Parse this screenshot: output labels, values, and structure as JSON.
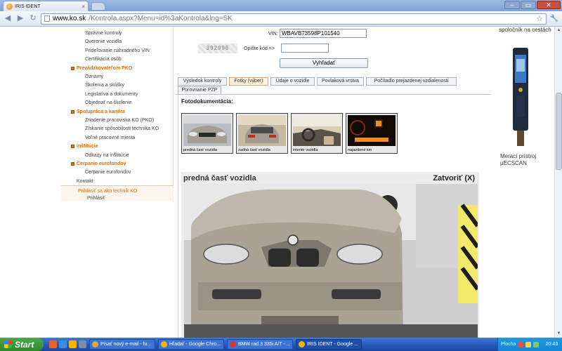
{
  "browser": {
    "tab_title": "IRIS IDENT",
    "tab_close": "×",
    "url_domain": "www.ko.sk",
    "url_path": "/Kontrola.aspx?Menu=id%3aKontrola&lng=SK",
    "back_icon": "◀",
    "forward_icon": "▶",
    "reload_icon": "↻",
    "star_icon": "☆",
    "wrench_icon": "🔧",
    "win_min": "–",
    "win_max": "▭",
    "win_close": "✕"
  },
  "leftnav": {
    "items": [
      {
        "label": "Správne kontroly",
        "kind": "sub"
      },
      {
        "label": "Overenie vozidla",
        "kind": "sub"
      },
      {
        "label": "Prideľovanie náhradného VIN",
        "kind": "sub"
      },
      {
        "label": "Certifikácia osôb",
        "kind": "sub"
      },
      {
        "label": "Prevádzkovateľom PKO",
        "kind": "section"
      },
      {
        "label": "Oznamy",
        "kind": "sub"
      },
      {
        "label": "Školenia a skúšky",
        "kind": "sub"
      },
      {
        "label": "Legislatíva a dokumenty",
        "kind": "sub"
      },
      {
        "label": "Objednať na školenie",
        "kind": "sub"
      },
      {
        "label": "Spolupráca a kariéra",
        "kind": "section"
      },
      {
        "label": "Zriadenie pracoviska KO (PKO)",
        "kind": "sub"
      },
      {
        "label": "Získanie spôsobilosti technika KO",
        "kind": "sub"
      },
      {
        "label": "Voľné pracovné miesta",
        "kind": "sub"
      },
      {
        "label": "Inštitúcie",
        "kind": "section"
      },
      {
        "label": "Odkazy na inštitúcie",
        "kind": "sub"
      },
      {
        "label": "Čerpanie eurofondov",
        "kind": "section"
      },
      {
        "label": "Čerpanie eurofondov",
        "kind": "sub"
      },
      {
        "label": "Kontakt",
        "kind": "plain"
      }
    ],
    "login_prompt": "Prihlásiť sa ako technik KO",
    "login_link": "Prihlásiť"
  },
  "form": {
    "vin_label": "VIN:",
    "vin_value": "WBAVB73598P101540",
    "captcha_text": "392996",
    "captcha_label": "Opíšte kód =>",
    "captcha_value": "",
    "search_button": "Vyhľadať"
  },
  "tabs": [
    {
      "label": "Výsledok kontroly",
      "active": false
    },
    {
      "label": "Fotky (výber)",
      "active": true
    },
    {
      "label": "Údaje o vozidle",
      "active": false
    },
    {
      "label": "Povlaková vrstva",
      "active": false
    },
    {
      "label": "Počítadlo prejazdenej vzdialenosti",
      "active": false
    },
    {
      "label": "Porovnanie PZP",
      "active": false
    }
  ],
  "photos": {
    "heading": "Fotodokumentácia:",
    "thumbnails": [
      {
        "caption": "predná časť vozidla"
      },
      {
        "caption": "zadná časť vozidla"
      },
      {
        "caption": "interiér vozidla"
      },
      {
        "caption": "najazdené km"
      }
    ],
    "viewer_caption": "predná časť vozidla",
    "viewer_close": "Zatvoriť (X)"
  },
  "rightad": {
    "top_text": "spoločník na cestách",
    "bottom_text": "Merací prístroj µECSCAN"
  },
  "taskbar": {
    "start_label": "Start",
    "tasks": [
      {
        "label": "Písať nový e-mail - fu...",
        "active": false,
        "color": "#e9a238"
      },
      {
        "label": "Hľadať - Google Chro...",
        "active": false,
        "color": "#f4b400"
      },
      {
        "label": "BMW rad 3 335i A/T - ...",
        "active": false,
        "color": "#d9362b"
      },
      {
        "label": "IRIS IDENT - Google ...",
        "active": true,
        "color": "#f4b400"
      }
    ],
    "tray_lang": "Plocha",
    "clock": "20:43"
  }
}
